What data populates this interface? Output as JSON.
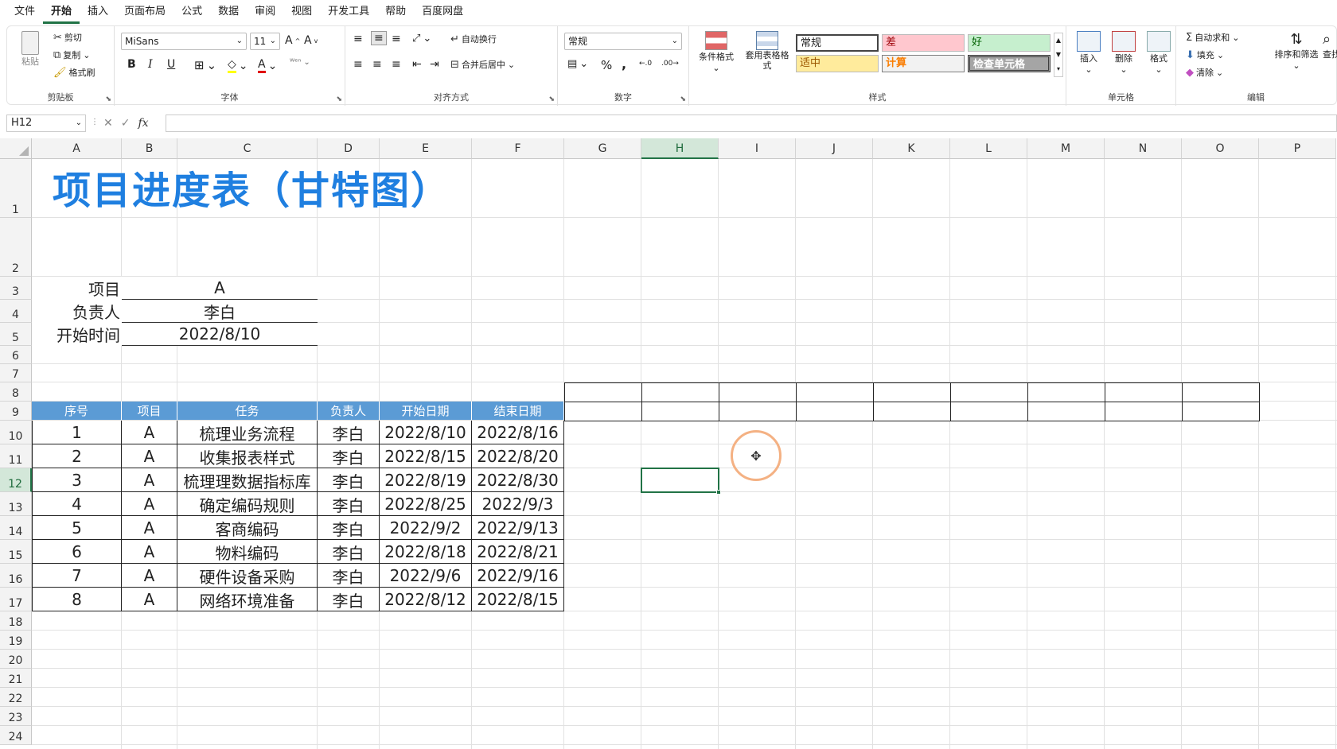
{
  "menu": [
    "文件",
    "开始",
    "插入",
    "页面布局",
    "公式",
    "数据",
    "审阅",
    "视图",
    "开发工具",
    "帮助",
    "百度网盘"
  ],
  "menu_active": "开始",
  "ribbon": {
    "clipboard": {
      "label": "剪贴板",
      "paste": "粘贴",
      "cut": "剪切",
      "copy": "复制",
      "format_painter": "格式刷"
    },
    "font": {
      "label": "字体",
      "name": "MiSans",
      "size": "11",
      "bold": "B",
      "italic": "I",
      "underline": "U"
    },
    "align": {
      "label": "对齐方式",
      "wrap": "自动换行",
      "merge": "合并后居中"
    },
    "number": {
      "label": "数字",
      "format": "常规",
      "percent": "%",
      "comma": ","
    },
    "styles": {
      "label": "样式",
      "cond_format": "条件格式",
      "table_format": "套用表格格式",
      "normal": "常规",
      "bad": "差",
      "good": "好",
      "neutral": "适中",
      "calc": "计算",
      "check": "检查单元格"
    },
    "cells": {
      "label": "单元格",
      "insert": "插入",
      "delete": "删除",
      "format": "格式"
    },
    "edit": {
      "label": "编辑",
      "autosum": "自动求和",
      "fill": "填充",
      "clear": "清除",
      "sort": "排序和筛选",
      "find": "查找"
    }
  },
  "formula_bar": {
    "name_box": "H12",
    "fx": "fx",
    "value": ""
  },
  "columns": [
    "A",
    "B",
    "C",
    "D",
    "E",
    "F",
    "G",
    "H",
    "I",
    "J",
    "K",
    "L",
    "M",
    "N",
    "O",
    "P"
  ],
  "selected_col": "H",
  "rows": [
    "1",
    "2",
    "3",
    "4",
    "5",
    "6",
    "7",
    "8",
    "9",
    "10",
    "11",
    "12",
    "13",
    "14",
    "15",
    "16",
    "17",
    "18",
    "19",
    "20",
    "21",
    "22",
    "23",
    "24"
  ],
  "selected_row": "12",
  "sheet": {
    "title": "项目进度表（甘特图）",
    "info": [
      {
        "label": "项目",
        "value": "A"
      },
      {
        "label": "负责人",
        "value": "李白"
      },
      {
        "label": "开始时间",
        "value": "2022/8/10"
      }
    ],
    "table_headers": [
      "序号",
      "项目",
      "任务",
      "负责人",
      "开始日期",
      "结束日期"
    ],
    "table_rows": [
      [
        "1",
        "A",
        "梳理业务流程",
        "李白",
        "2022/8/10",
        "2022/8/16"
      ],
      [
        "2",
        "A",
        "收集报表样式",
        "李白",
        "2022/8/15",
        "2022/8/20"
      ],
      [
        "3",
        "A",
        "梳理理数据指标库",
        "李白",
        "2022/8/19",
        "2022/8/30"
      ],
      [
        "4",
        "A",
        "确定编码规则",
        "李白",
        "2022/8/25",
        "2022/9/3"
      ],
      [
        "5",
        "A",
        "客商编码",
        "李白",
        "2022/9/2",
        "2022/9/13"
      ],
      [
        "6",
        "A",
        "物料编码",
        "李白",
        "2022/8/18",
        "2022/8/21"
      ],
      [
        "7",
        "A",
        "硬件设备采购",
        "李白",
        "2022/9/6",
        "2022/9/16"
      ],
      [
        "8",
        "A",
        "网络环境准备",
        "李白",
        "2022/8/12",
        "2022/8/15"
      ]
    ]
  },
  "colors": {
    "accent": "#217346",
    "title_blue": "#1f7fe0",
    "header_blue": "#5b9bd5",
    "bad_bg": "#ffc7ce",
    "good_bg": "#c6efce",
    "neutral_bg": "#ffeb9c",
    "cursor_ring": "#f4b183"
  }
}
